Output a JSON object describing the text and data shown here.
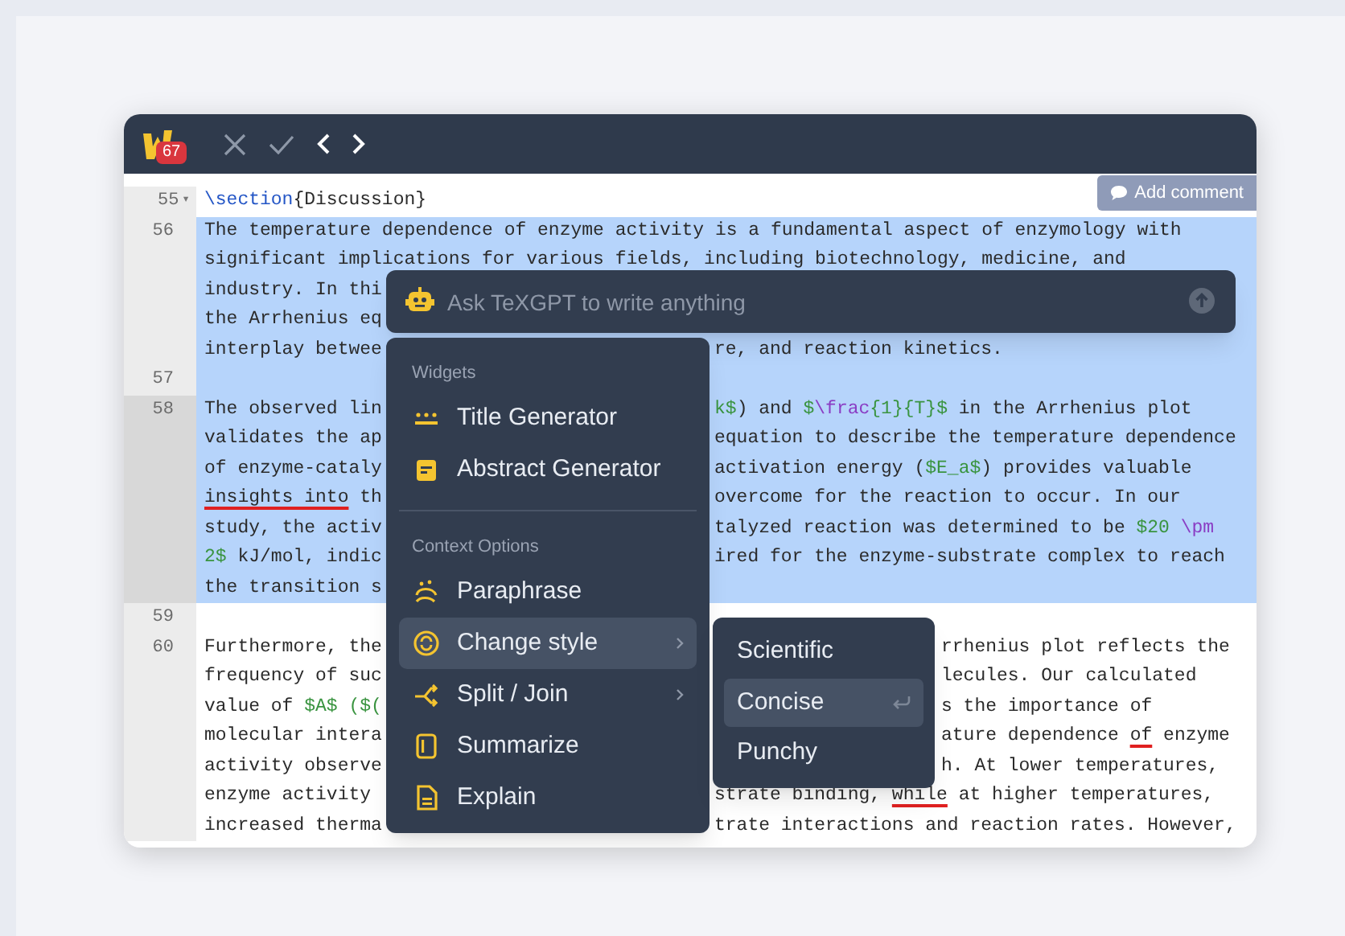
{
  "toolbar": {
    "badge": "67"
  },
  "add_comment": "Add comment",
  "editor": {
    "lines": [
      {
        "number": "55",
        "fold": "▾",
        "active": false,
        "selected": false,
        "rows": [
          {
            "left": [
              {
                "text": "\\section",
                "kind": "keyword"
              },
              {
                "text": "{Discussion}",
                "kind": "text"
              }
            ]
          }
        ]
      },
      {
        "number": "56",
        "active": false,
        "selected": true,
        "rows": [
          {
            "left": "The temperature dependence of enzyme activity is a fundamental aspect of enzymology with"
          },
          {
            "left": "significant implications for various fields, including biotechnology, medicine, and"
          },
          {
            "left": "industry. In thi"
          },
          {
            "left": "the Arrhenius eq"
          },
          {
            "left": "interplay betwee",
            "right": "re, and reaction kinetics."
          }
        ]
      },
      {
        "number": "57",
        "active": false,
        "selected": true,
        "rows": [
          {
            "left": ""
          }
        ]
      },
      {
        "number": "58",
        "active": true,
        "selected": true,
        "rows": [
          {
            "left": "The observed lin",
            "right": [
              {
                "text": "k$",
                "kind": "math"
              },
              {
                "text": ") and ",
                "kind": "text"
              },
              {
                "text": "$",
                "kind": "math"
              },
              {
                "text": "\\frac",
                "kind": "command"
              },
              {
                "text": "{1}{T}$",
                "kind": "math"
              },
              {
                "text": " in the Arrhenius plot",
                "kind": "text"
              }
            ]
          },
          {
            "left": "validates the ap",
            "right": "equation to describe the temperature dependence"
          },
          {
            "left": "of enzyme-cataly",
            "right": [
              {
                "text": "activation energy (",
                "kind": "text"
              },
              {
                "text": "$E_a$",
                "kind": "math"
              },
              {
                "text": ") provides valuable",
                "kind": "text"
              }
            ]
          },
          {
            "left": [
              {
                "text": "insights into",
                "kind": "flagged"
              },
              {
                "text": " th",
                "kind": "text"
              }
            ],
            "right": "overcome for the reaction to occur. In our"
          },
          {
            "left": "study, the activ",
            "right": [
              {
                "text": "talyzed reaction was determined to be ",
                "kind": "text"
              },
              {
                "text": "$20 ",
                "kind": "math"
              },
              {
                "text": "\\pm",
                "kind": "command"
              }
            ]
          },
          {
            "left": [
              {
                "text": "2$",
                "kind": "math"
              },
              {
                "text": " kJ/mol, indic",
                "kind": "text"
              }
            ],
            "right": "ired for the enzyme-substrate complex to reach"
          },
          {
            "left": "the transition s"
          }
        ]
      },
      {
        "number": "59",
        "active": false,
        "selected": false,
        "rows": [
          {
            "left": ""
          }
        ]
      },
      {
        "number": "60",
        "active": false,
        "selected": false,
        "rows": [
          {
            "left": "Furthermore, the",
            "right": "rrhenius plot reflects the"
          },
          {
            "left": "frequency of suc",
            "right": "lecules. Our calculated"
          },
          {
            "left": [
              {
                "text": "value of ",
                "kind": "text"
              },
              {
                "text": "$A$ ($(",
                "kind": "math"
              }
            ],
            "right": "s the importance of"
          },
          {
            "left": "molecular intera",
            "right": [
              {
                "text": "ature dependence ",
                "kind": "text"
              },
              {
                "text": "of",
                "kind": "flagged"
              },
              {
                "text": " enzyme",
                "kind": "text"
              }
            ]
          },
          {
            "left": "activity observe",
            "right": "h. At lower temperatures,"
          },
          {
            "left": "enzyme activity",
            "right": [
              {
                "text": "strate binding, ",
                "kind": "text"
              },
              {
                "text": "while",
                "kind": "flagged"
              },
              {
                "text": " at higher temperatures,",
                "kind": "text"
              }
            ]
          },
          {
            "left": "increased therma",
            "right": "trate interactions and reaction rates. However,"
          }
        ]
      }
    ]
  },
  "ask_bar": {
    "placeholder": "Ask TeXGPT to write anything"
  },
  "menu": {
    "sections": [
      {
        "heading": "Widgets",
        "items": [
          {
            "label": "Title Generator",
            "selected": false,
            "submenu": false
          },
          {
            "label": "Abstract Generator",
            "selected": false,
            "submenu": false
          }
        ]
      },
      {
        "heading": "Context Options",
        "items": [
          {
            "label": "Paraphrase",
            "selected": false,
            "submenu": false
          },
          {
            "label": "Change style",
            "selected": true,
            "submenu": true
          },
          {
            "label": "Split / Join",
            "selected": false,
            "submenu": true
          },
          {
            "label": "Summarize",
            "selected": false,
            "submenu": false
          },
          {
            "label": "Explain",
            "selected": false,
            "submenu": false
          }
        ]
      }
    ]
  },
  "submenu": {
    "items": [
      {
        "label": "Scientific",
        "selected": false
      },
      {
        "label": "Concise",
        "selected": true
      },
      {
        "label": "Punchy",
        "selected": false
      }
    ]
  }
}
